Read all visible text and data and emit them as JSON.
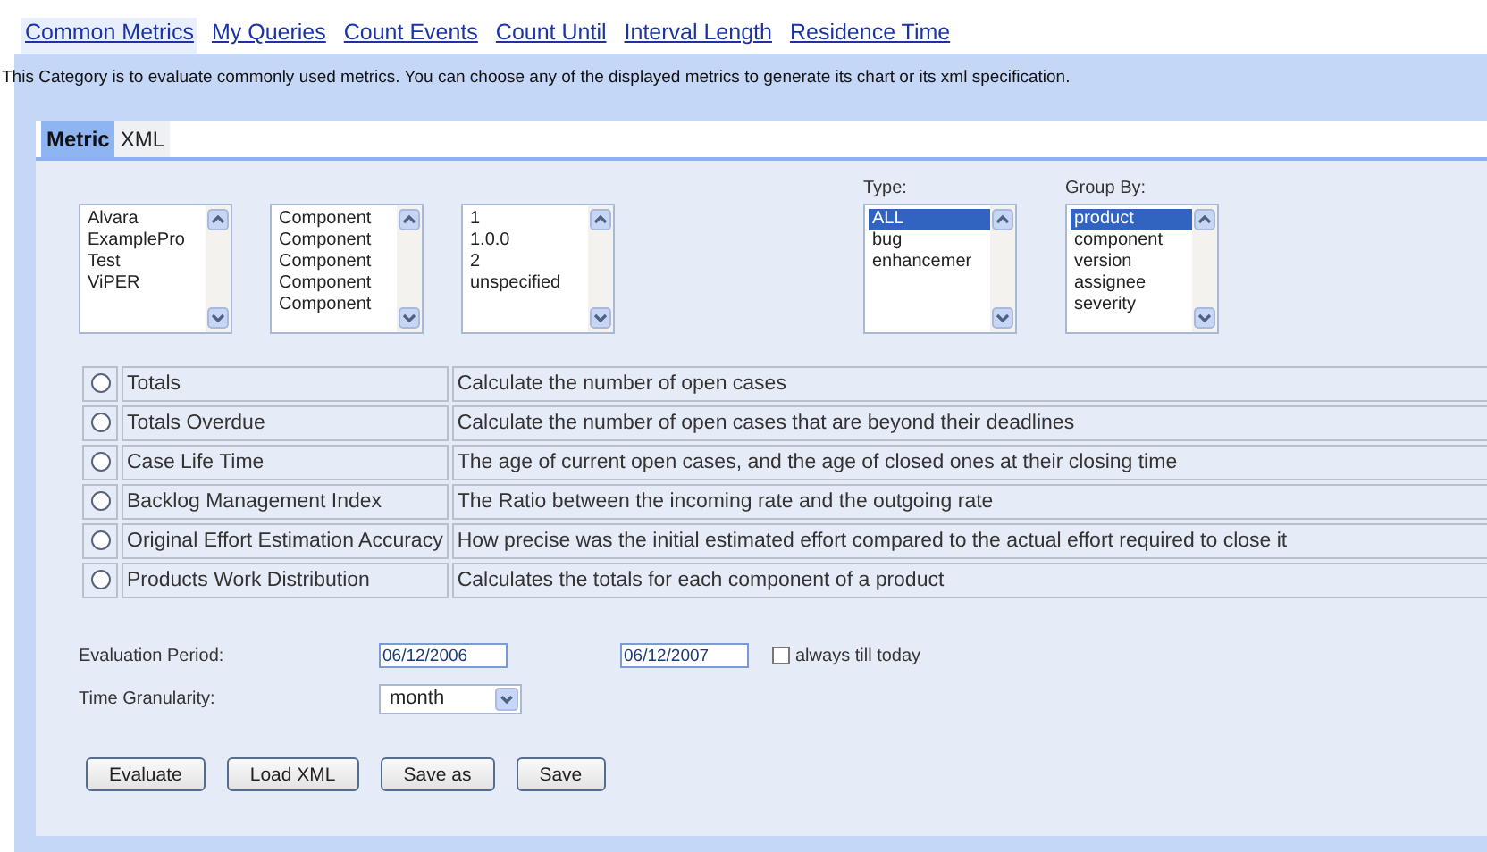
{
  "nav": [
    {
      "label": "Common  Metrics",
      "selected": true
    },
    {
      "label": "My Queries",
      "selected": false
    },
    {
      "label": "Count Events",
      "selected": false
    },
    {
      "label": "Count Until",
      "selected": false
    },
    {
      "label": "Interval Length",
      "selected": false
    },
    {
      "label": "Residence Time",
      "selected": false
    }
  ],
  "description": "This Category is to evaluate commonly used metrics. You can choose any of the displayed metrics to generate its chart or its xml specification.",
  "tabs": [
    {
      "label": "Metric",
      "selected": true
    },
    {
      "label": "XML",
      "selected": false
    }
  ],
  "lists": [
    {
      "options": [
        {
          "label": "Alvara",
          "selected": false
        },
        {
          "label": "ExamplePro",
          "selected": false
        },
        {
          "label": "Test",
          "selected": false
        },
        {
          "label": "ViPER",
          "selected": false
        }
      ]
    },
    {
      "options": [
        {
          "label": "Component",
          "selected": false
        },
        {
          "label": "Component",
          "selected": false
        },
        {
          "label": "Component",
          "selected": false
        },
        {
          "label": "Component",
          "selected": false
        },
        {
          "label": "Component",
          "selected": false
        }
      ]
    },
    {
      "options": [
        {
          "label": "1",
          "selected": false
        },
        {
          "label": "1.0.0",
          "selected": false
        },
        {
          "label": "2",
          "selected": false
        },
        {
          "label": "unspecified",
          "selected": false
        }
      ]
    },
    {
      "label": "Type:",
      "options": [
        {
          "label": "ALL",
          "selected": true
        },
        {
          "label": "bug",
          "selected": false
        },
        {
          "label": "enhancemer",
          "selected": false
        }
      ]
    },
    {
      "label": "Group By:",
      "options": [
        {
          "label": "product",
          "selected": true
        },
        {
          "label": "component",
          "selected": false
        },
        {
          "label": "version",
          "selected": false
        },
        {
          "label": "assignee",
          "selected": false
        },
        {
          "label": "severity",
          "selected": false
        }
      ]
    }
  ],
  "metrics": [
    {
      "name": "Totals",
      "description": "Calculate the number of open cases",
      "checked": false
    },
    {
      "name": "Totals Overdue",
      "description": "Calculate the number of open cases that are beyond their deadlines",
      "checked": false
    },
    {
      "name": "Case Life Time",
      "description": "The age of current open cases, and the age of closed ones at their closing time",
      "checked": false
    },
    {
      "name": "Backlog Management Index",
      "description": "The Ratio between the incoming rate and the outgoing rate",
      "checked": false
    },
    {
      "name": "Original Effort Estimation Accuracy",
      "description": "How precise was the initial estimated effort compared to the actual effort required to close it",
      "checked": false
    },
    {
      "name": "Products Work Distribution",
      "description": "Calculates the totals for each component of a product",
      "checked": false
    }
  ],
  "evaluation_period": {
    "label": "Evaluation Period:",
    "from": "06/12/2006",
    "to": "06/12/2007",
    "always_label": "always till today",
    "always_checked": false
  },
  "time_granularity": {
    "label": "Time Granularity:",
    "value": "month"
  },
  "buttons": [
    "Evaluate",
    "Load XML",
    "Save as",
    "Save"
  ]
}
